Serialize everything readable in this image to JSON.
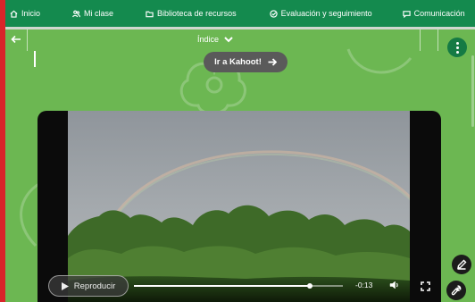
{
  "nav": {
    "items": [
      {
        "label": "Inicio",
        "icon": "home-icon"
      },
      {
        "label": "Mi clase",
        "icon": "people-icon"
      },
      {
        "label": "Biblioteca de recursos",
        "icon": "folder-icon"
      },
      {
        "label": "Evaluación y seguimiento",
        "icon": "check-circle-icon"
      },
      {
        "label": "Comunicación",
        "icon": "chat-icon"
      }
    ]
  },
  "lesson": {
    "index_label": "Índice"
  },
  "kahoot": {
    "label": "Ir a Kahoot!"
  },
  "video": {
    "play_label": "Reproducir",
    "time_remaining": "-0:13",
    "progress_fraction": 0.84
  },
  "colors": {
    "nav_bg": "#148a4e",
    "page_bg": "#6cb752",
    "frame_red": "#d9252a"
  }
}
